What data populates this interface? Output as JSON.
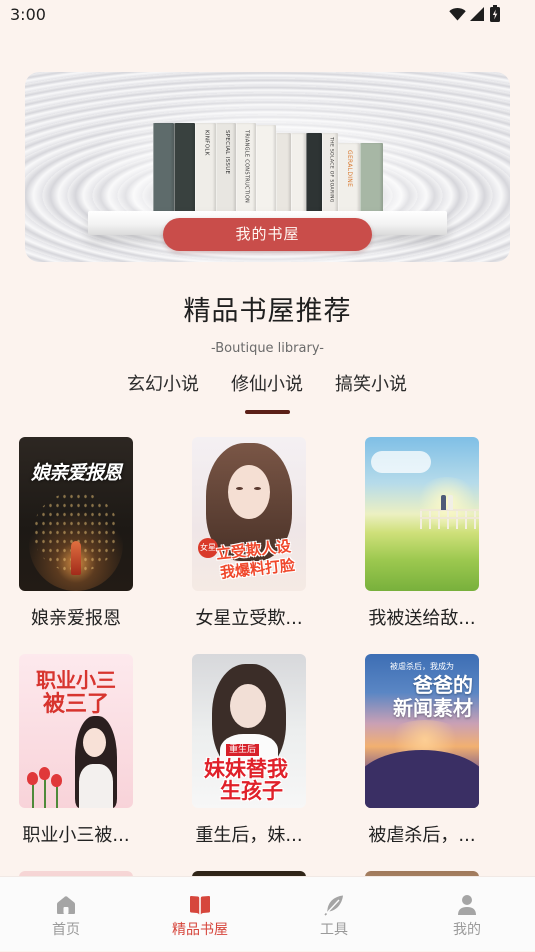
{
  "status_bar": {
    "time": "3:00",
    "icons": [
      "wifi-icon",
      "signal-icon",
      "battery-icon"
    ]
  },
  "banner": {
    "button_label": "我的书屋",
    "spine_labels": [
      "KINFOLK",
      "SPECIAL ISSUE",
      "TRIANGLE CONSTRUCTION",
      "THE SOLACE OF SOARING",
      "GERALDINE"
    ]
  },
  "section": {
    "title": "精品书屋推荐",
    "subtitle": "-Boutique library-"
  },
  "tabs": [
    {
      "label": "玄幻小说",
      "selected": false
    },
    {
      "label": "修仙小说",
      "selected": true
    },
    {
      "label": "搞笑小说",
      "selected": false
    }
  ],
  "books": [
    {
      "title": "娘亲爱报恩",
      "cover_text": [
        "娘亲爱报恩"
      ]
    },
    {
      "title": "女星立受欺...",
      "cover_text": [
        "女星",
        "立受欺人设",
        "我爆料打脸"
      ]
    },
    {
      "title": "我被送给敌..."
    },
    {
      "title": "职业小三被...",
      "cover_text": [
        "职业小三",
        "被三了"
      ]
    },
    {
      "title": "重生后，妹...",
      "cover_text": [
        "重生后",
        "妹妹替我",
        "生孩子"
      ]
    },
    {
      "title": "被虐杀后，...",
      "cover_text": [
        "被虐杀后，我成为",
        "爸爸的",
        "新闻素材"
      ]
    }
  ],
  "bottom_nav": [
    {
      "label": "首页",
      "icon": "home-icon",
      "active": false
    },
    {
      "label": "精品书屋",
      "icon": "book-icon",
      "active": true
    },
    {
      "label": "工具",
      "icon": "feather-icon",
      "active": false
    },
    {
      "label": "我的",
      "icon": "person-icon",
      "active": false
    }
  ],
  "colors": {
    "background": "#fcf3ee",
    "accent": "#d6463c",
    "tab_indicator": "#5b1f17",
    "banner_button": "#c94d4a",
    "text": "#222222",
    "nav_inactive": "#9a9a9a"
  }
}
